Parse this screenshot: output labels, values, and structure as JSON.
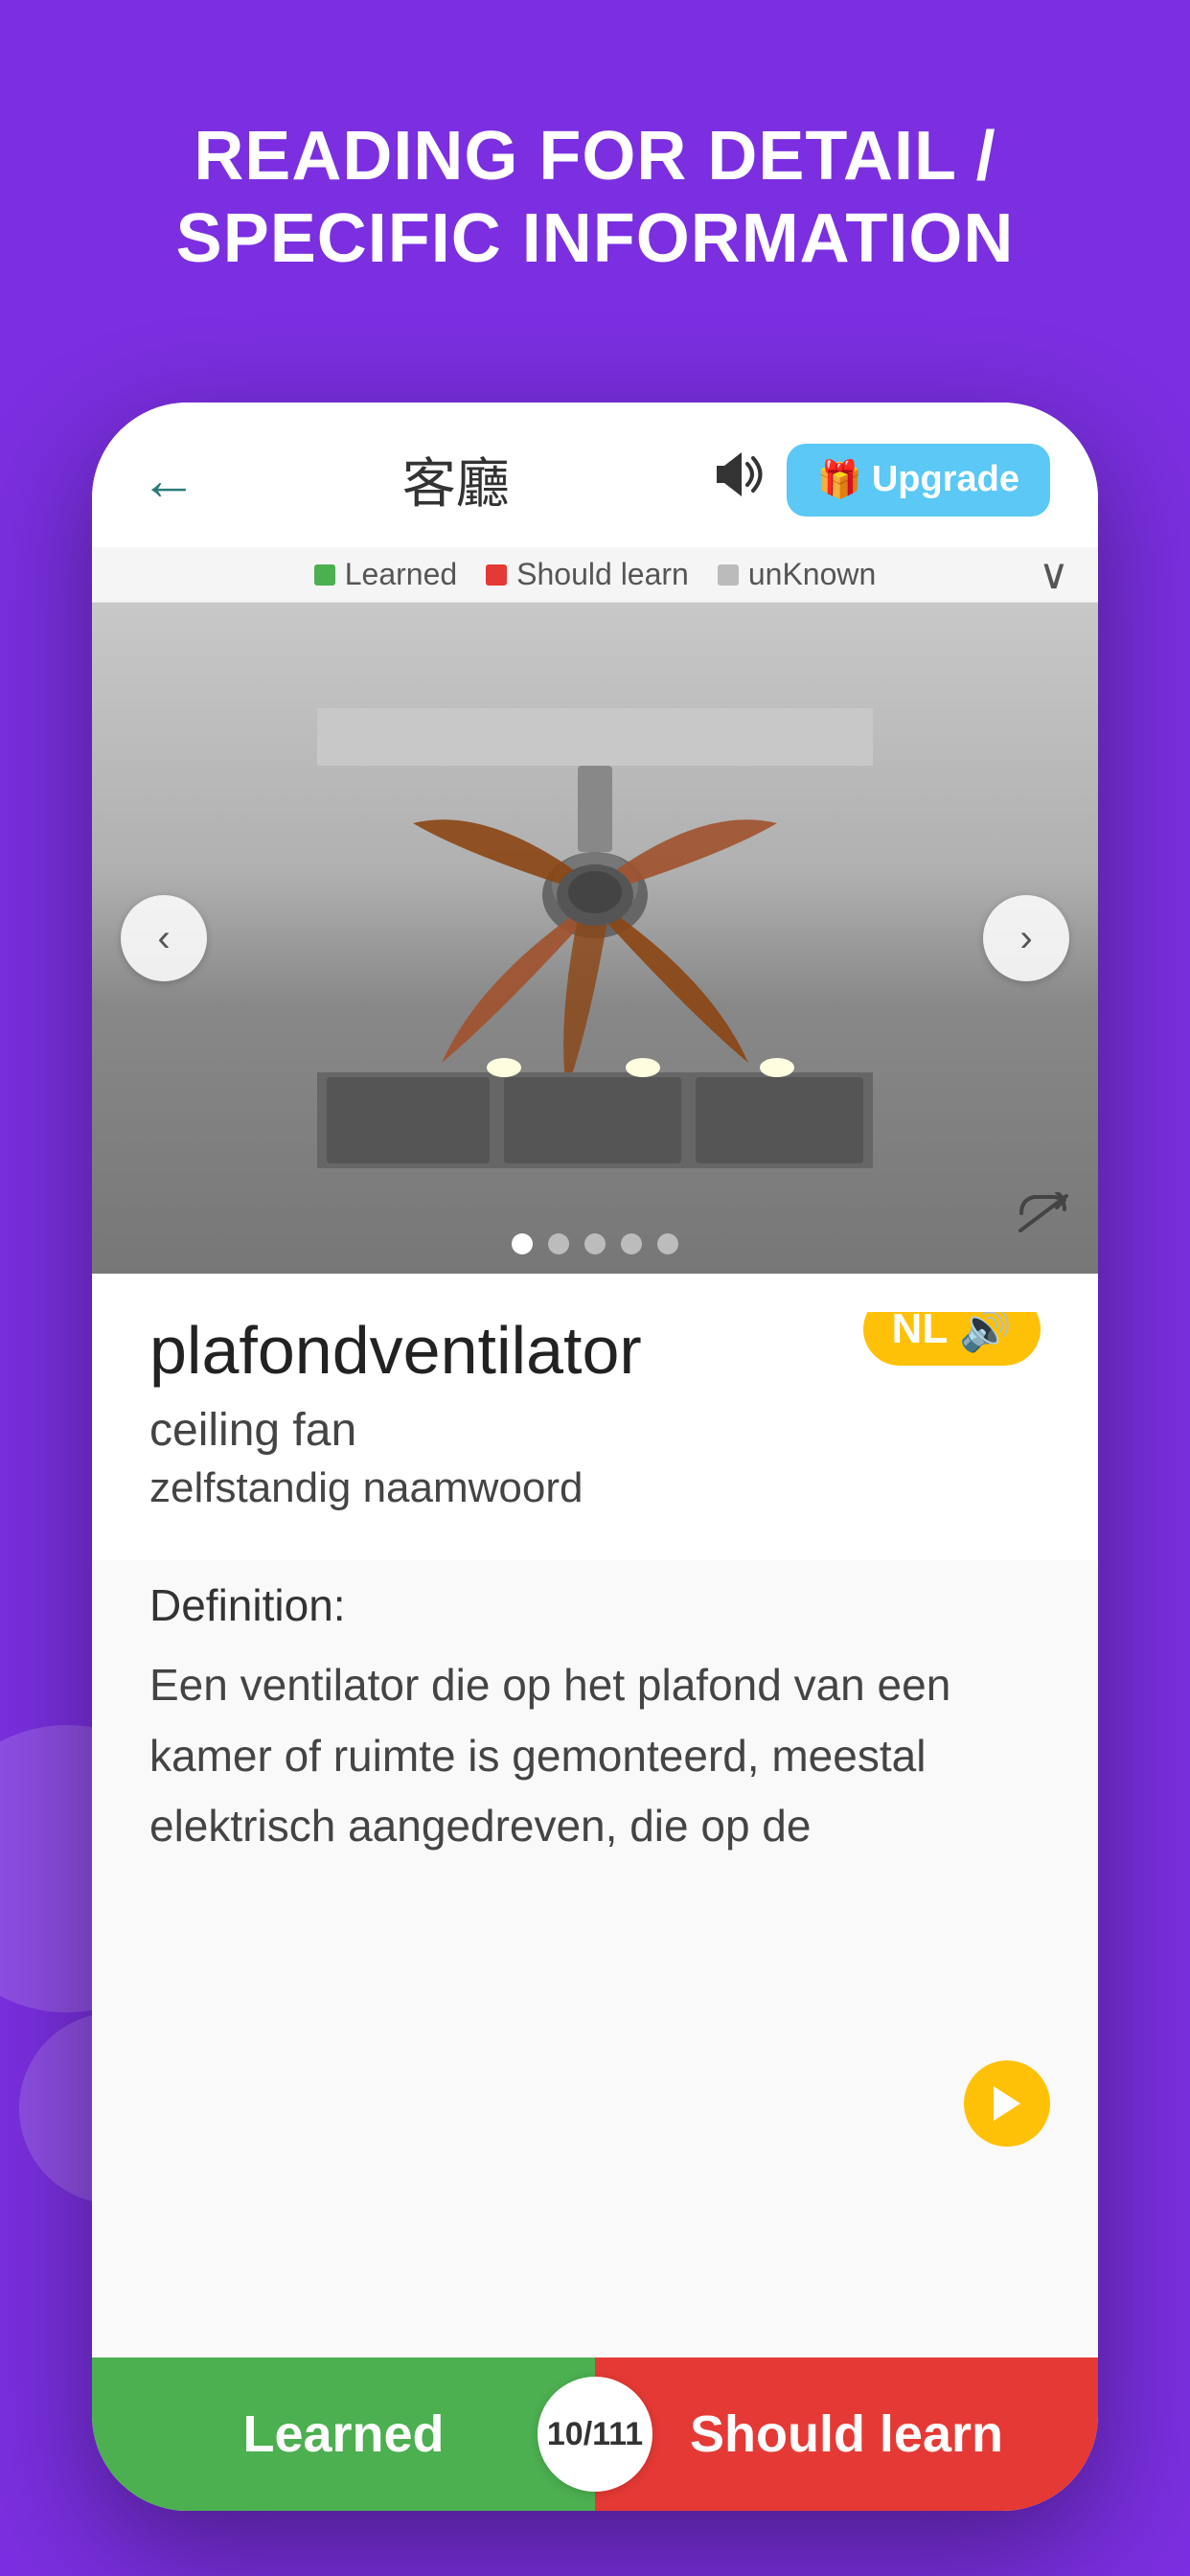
{
  "page": {
    "background_color": "#7B2FE0",
    "title": "READING FOR DETAIL / SPECIFIC INFORMATION"
  },
  "header": {
    "back_label": "←",
    "title": "客廳",
    "audio_icon": "🔊",
    "upgrade_icon": "🎁",
    "upgrade_label": "Upgrade"
  },
  "legend": {
    "learned_label": "Learned",
    "should_learn_label": "Should learn",
    "unknown_label": "unKnown"
  },
  "carousel": {
    "dots_count": 5,
    "active_dot": 0,
    "nav_left": "‹",
    "nav_right": "›"
  },
  "word": {
    "main": "plafondventilator",
    "translation": "ceiling fan",
    "pos": "zelfstandig naamwoord",
    "language_badge": "NL"
  },
  "definition": {
    "label": "Definition:",
    "text": "Een ventilator die op het plafond van een kamer of ruimte is gemonteerd, meestal elektrisch aangedreven, die op de"
  },
  "bottom_bar": {
    "learned_label": "Learned",
    "should_learn_label": "Should learn",
    "counter": "10/111"
  }
}
